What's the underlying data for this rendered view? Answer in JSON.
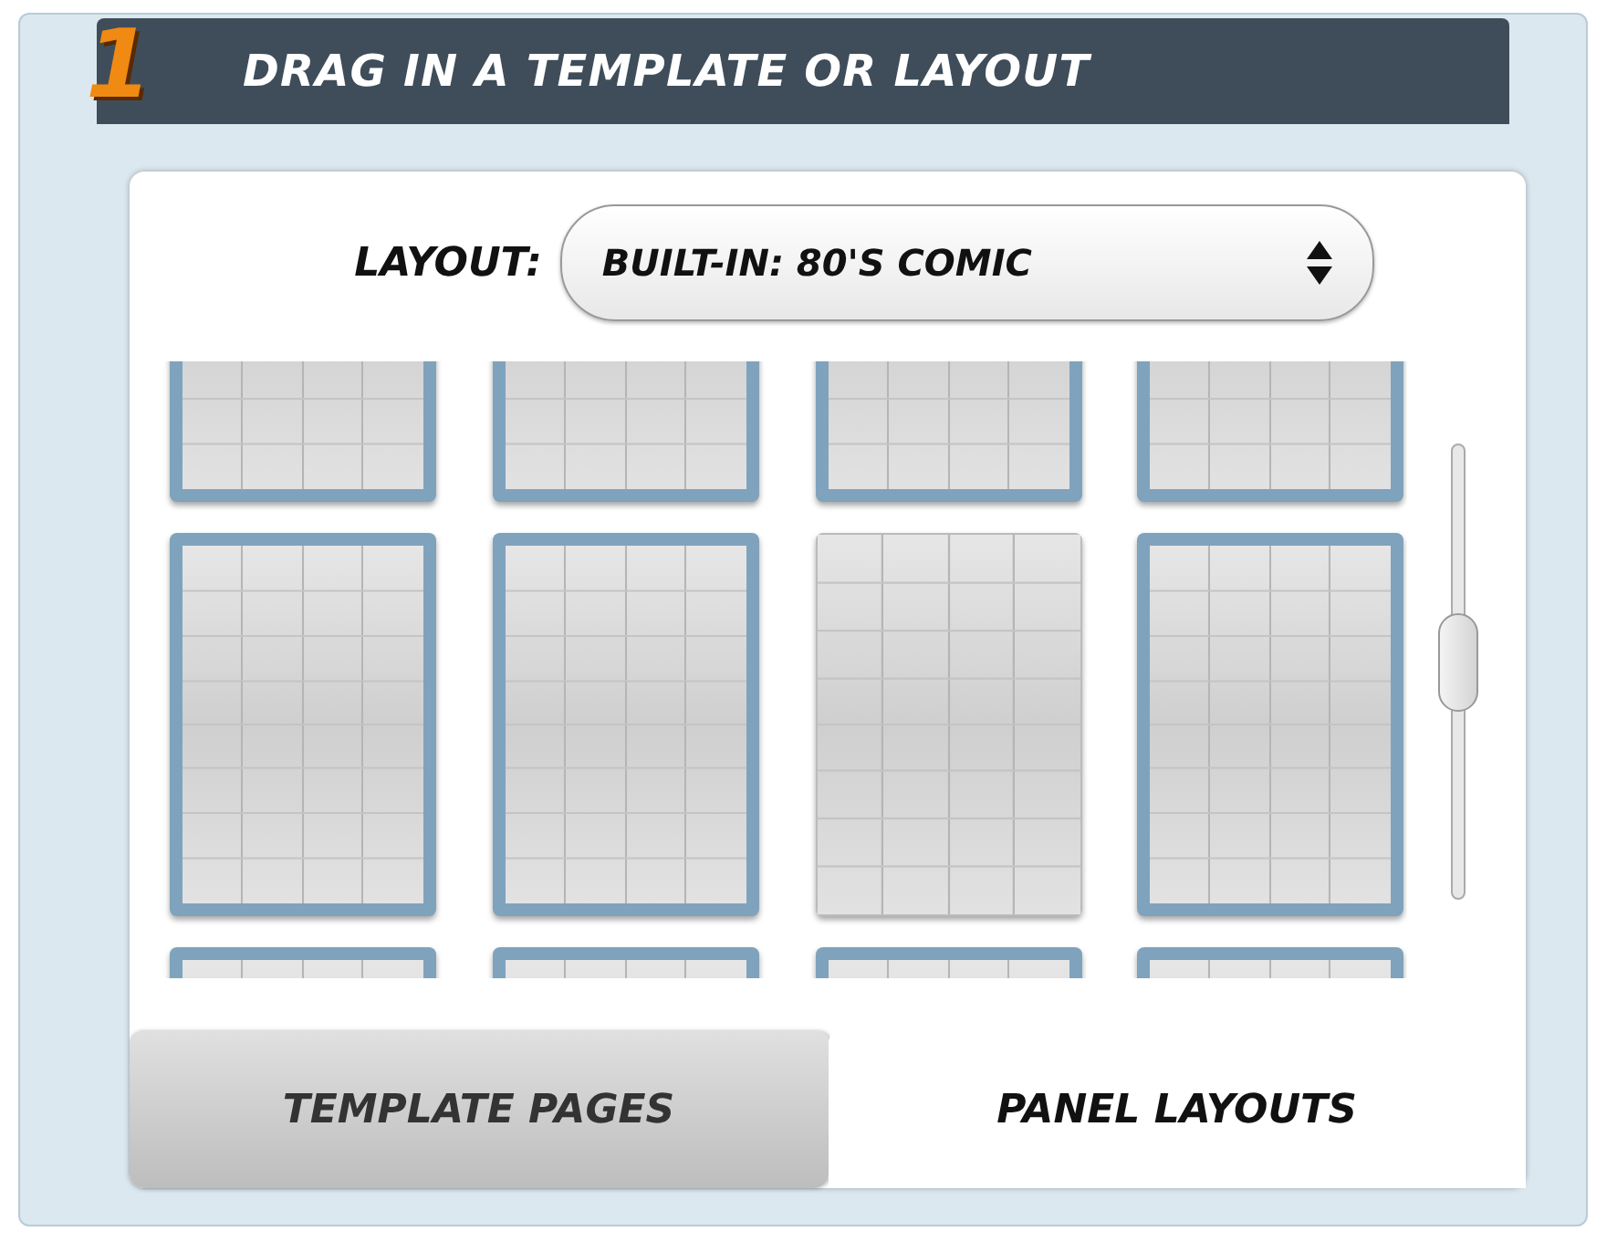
{
  "header": {
    "step": "1",
    "title": "DRAG IN A TEMPLATE OR LAYOUT"
  },
  "layout_select": {
    "label": "LAYOUT:",
    "value": "BUILT-IN: 80'S COMIC"
  },
  "thumbnails": [
    {
      "bordered": true
    },
    {
      "bordered": true
    },
    {
      "bordered": true
    },
    {
      "bordered": true
    },
    {
      "bordered": true
    },
    {
      "bordered": true
    },
    {
      "bordered": false
    },
    {
      "bordered": true
    },
    {
      "bordered": true
    },
    {
      "bordered": true
    },
    {
      "bordered": true
    },
    {
      "bordered": true
    }
  ],
  "slider": {
    "level": 0.48
  },
  "tabs": [
    {
      "label": "TEMPLATE PAGES",
      "selected": false
    },
    {
      "label": "PANEL LAYOUTS",
      "selected": true
    }
  ]
}
